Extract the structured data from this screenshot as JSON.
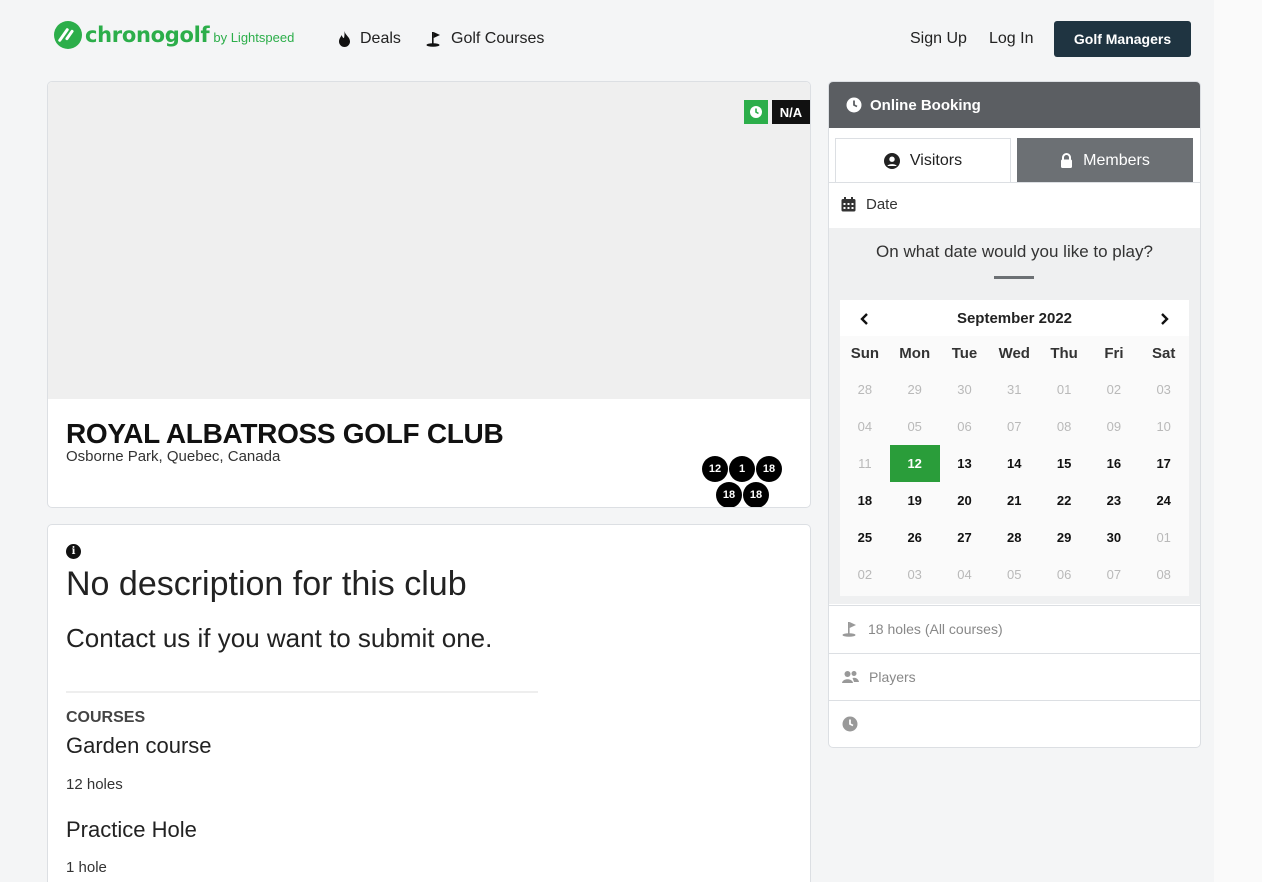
{
  "nav": {
    "logo_word": "chronogolf",
    "logo_by": "by Lightspeed",
    "deals": "Deals",
    "golf_courses": "Golf Courses",
    "sign_up": "Sign Up",
    "log_in": "Log In",
    "golf_managers": "Golf Managers"
  },
  "club": {
    "badge": "N/A",
    "name": "ROYAL ALBATROSS GOLF CLUB",
    "location": "Osborne Park, Quebec, Canada",
    "hole_badges": [
      "12",
      "1",
      "18",
      "18",
      "18"
    ]
  },
  "description": {
    "title": "No description for this club",
    "subtitle": "Contact us if you want to submit one.",
    "courses_heading": "COURSES",
    "courses": [
      {
        "name": "Garden course",
        "holes": "12 holes"
      },
      {
        "name": "Practice Hole",
        "holes": "1 hole"
      }
    ]
  },
  "booking": {
    "header": "Online Booking",
    "tab_visitors": "Visitors",
    "tab_members": "Members",
    "date_label": "Date",
    "question": "On what date would you like to play?",
    "calendar": {
      "month": "September 2022",
      "dow": [
        "Sun",
        "Mon",
        "Tue",
        "Wed",
        "Thu",
        "Fri",
        "Sat"
      ],
      "selected": "12",
      "weeks": [
        [
          "28",
          "29",
          "30",
          "31",
          "01",
          "02",
          "03"
        ],
        [
          "04",
          "05",
          "06",
          "07",
          "08",
          "09",
          "10"
        ],
        [
          "11",
          "12",
          "13",
          "14",
          "15",
          "16",
          "17"
        ],
        [
          "18",
          "19",
          "20",
          "21",
          "22",
          "23",
          "24"
        ],
        [
          "25",
          "26",
          "27",
          "28",
          "29",
          "30",
          "01"
        ],
        [
          "02",
          "03",
          "04",
          "05",
          "06",
          "07",
          "08"
        ]
      ],
      "muted": [
        [
          1,
          1,
          1,
          1,
          1,
          1,
          1
        ],
        [
          1,
          1,
          1,
          1,
          1,
          1,
          1
        ],
        [
          1,
          0,
          0,
          0,
          0,
          0,
          0
        ],
        [
          0,
          0,
          0,
          0,
          0,
          0,
          0
        ],
        [
          0,
          0,
          0,
          0,
          0,
          0,
          1
        ],
        [
          1,
          1,
          1,
          1,
          1,
          1,
          1
        ]
      ]
    },
    "holes_row": "18 holes (All courses)",
    "players_row": "Players"
  },
  "colors": {
    "brand_green": "#2cae4a",
    "selected_day": "#2a9d3a",
    "header_gray": "#5b5e62",
    "dark_button": "#1f3441"
  }
}
